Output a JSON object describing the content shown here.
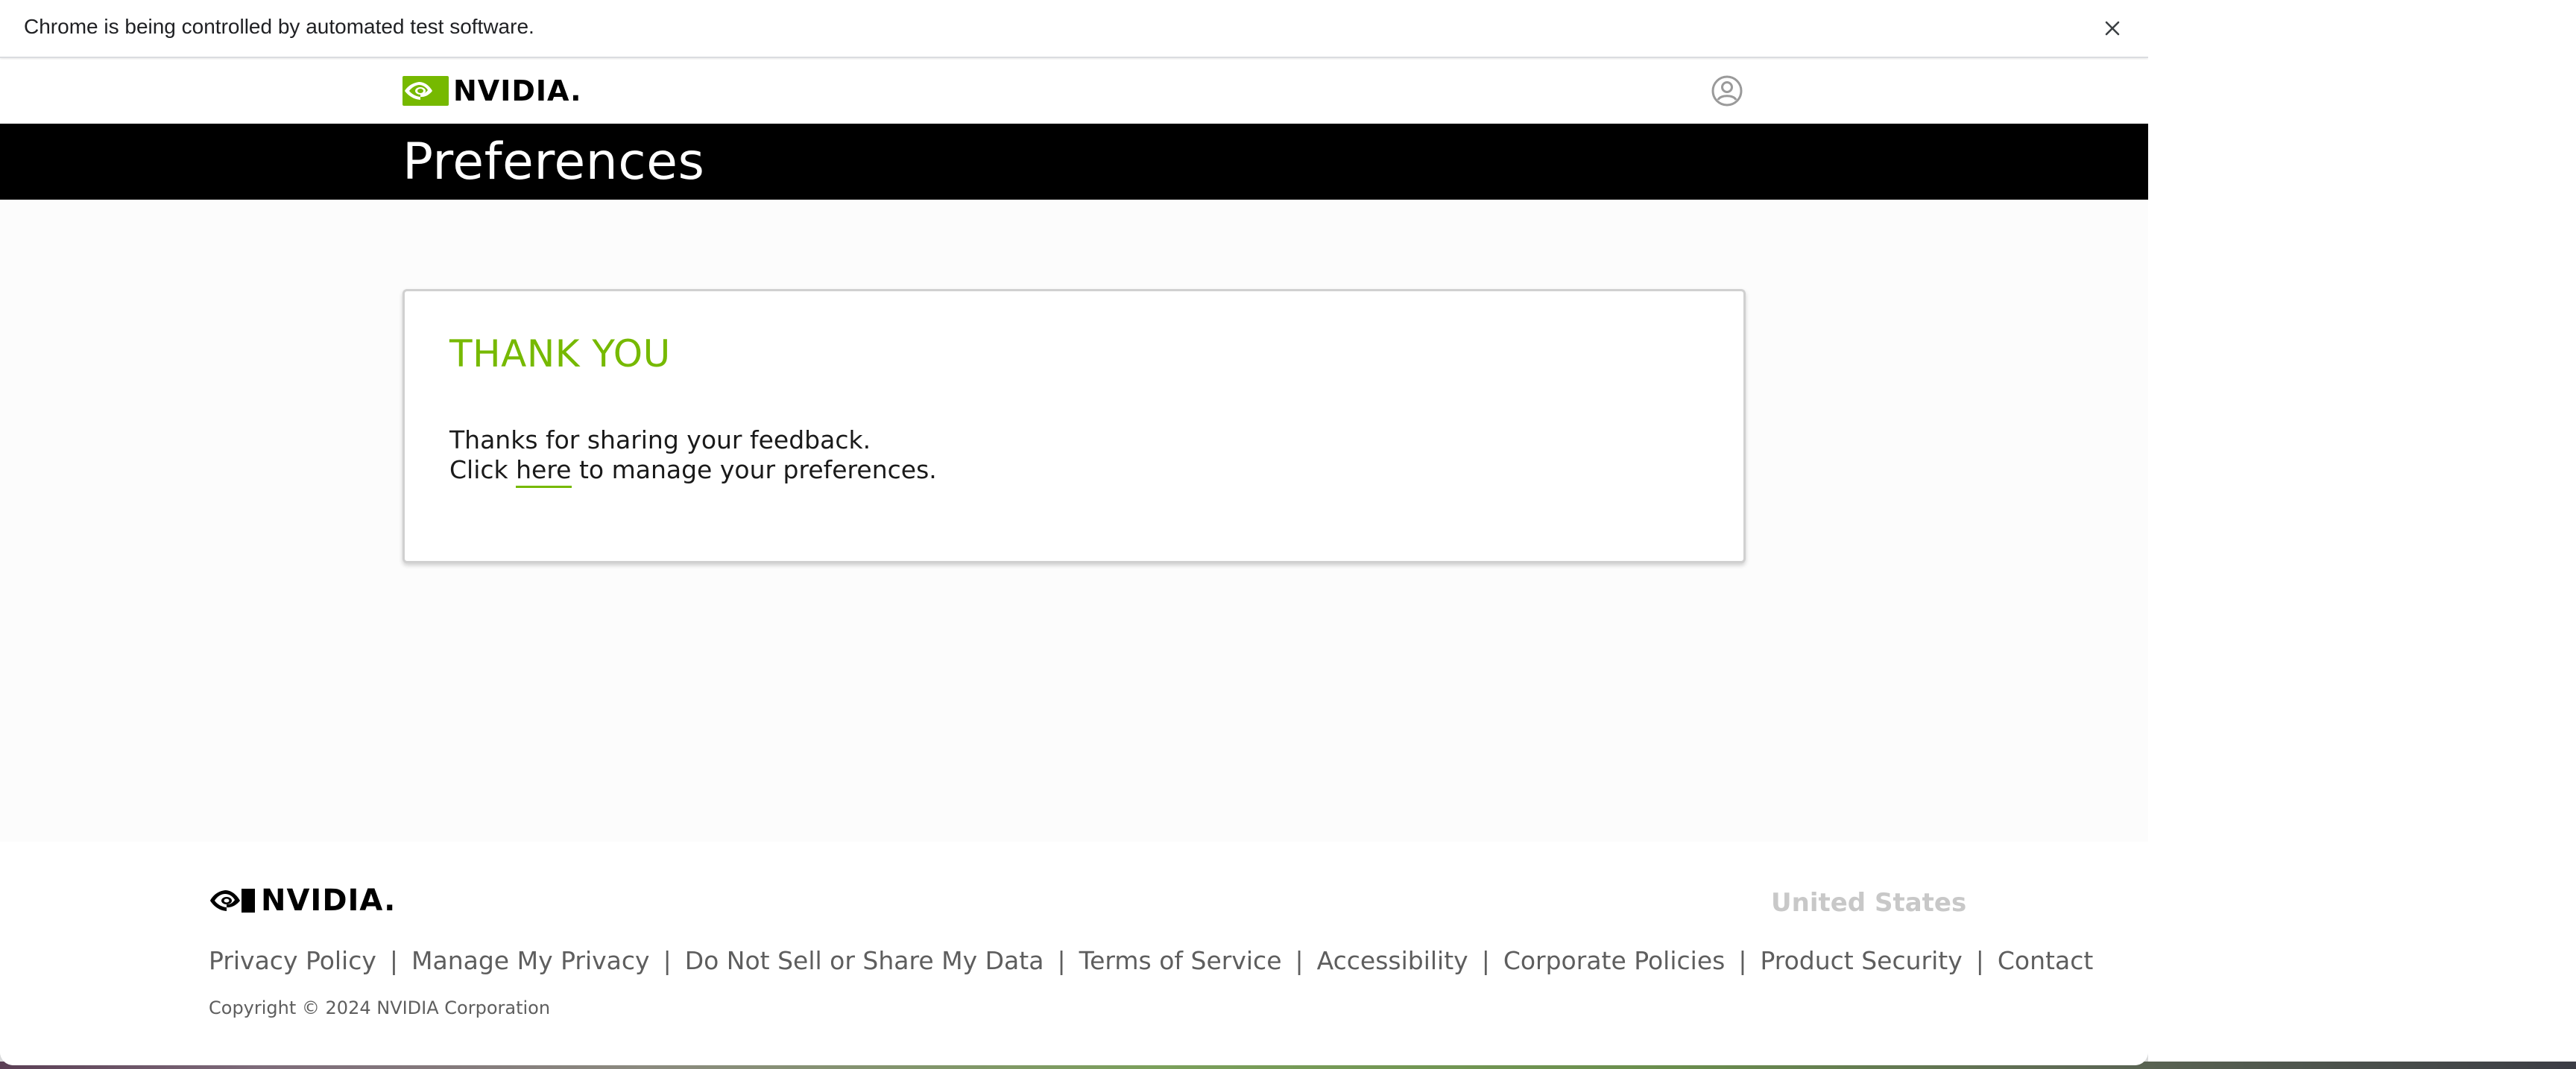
{
  "browser": {
    "infobar_text": "Chrome is being controlled by automated test software.",
    "close_icon": "close-icon"
  },
  "header": {
    "logo_text": "NVIDIA.",
    "logo_icon": "nvidia-eye-logo",
    "account_icon": "account-circle-icon"
  },
  "title_band": {
    "title": "Preferences"
  },
  "card": {
    "heading": "THANK YOU",
    "line1": "Thanks for sharing your feedback.",
    "line2_before": "Click ",
    "link_text": "here",
    "line2_after": " to manage your preferences."
  },
  "footer": {
    "logo_text": "NVIDIA.",
    "region": "United States",
    "links": [
      {
        "label": "Privacy Policy"
      },
      {
        "label": "Manage My Privacy"
      },
      {
        "label": "Do Not Sell or Share My Data"
      },
      {
        "label": "Terms of Service"
      },
      {
        "label": "Accessibility"
      },
      {
        "label": "Corporate Policies"
      },
      {
        "label": "Product Security"
      },
      {
        "label": "Contact"
      }
    ],
    "separator": "|",
    "copyright": "Copyright © 2024 NVIDIA Corporation"
  },
  "colors": {
    "brand_green": "#76b900",
    "title_band": "#000000",
    "footer_text": "#5e5e5e"
  }
}
